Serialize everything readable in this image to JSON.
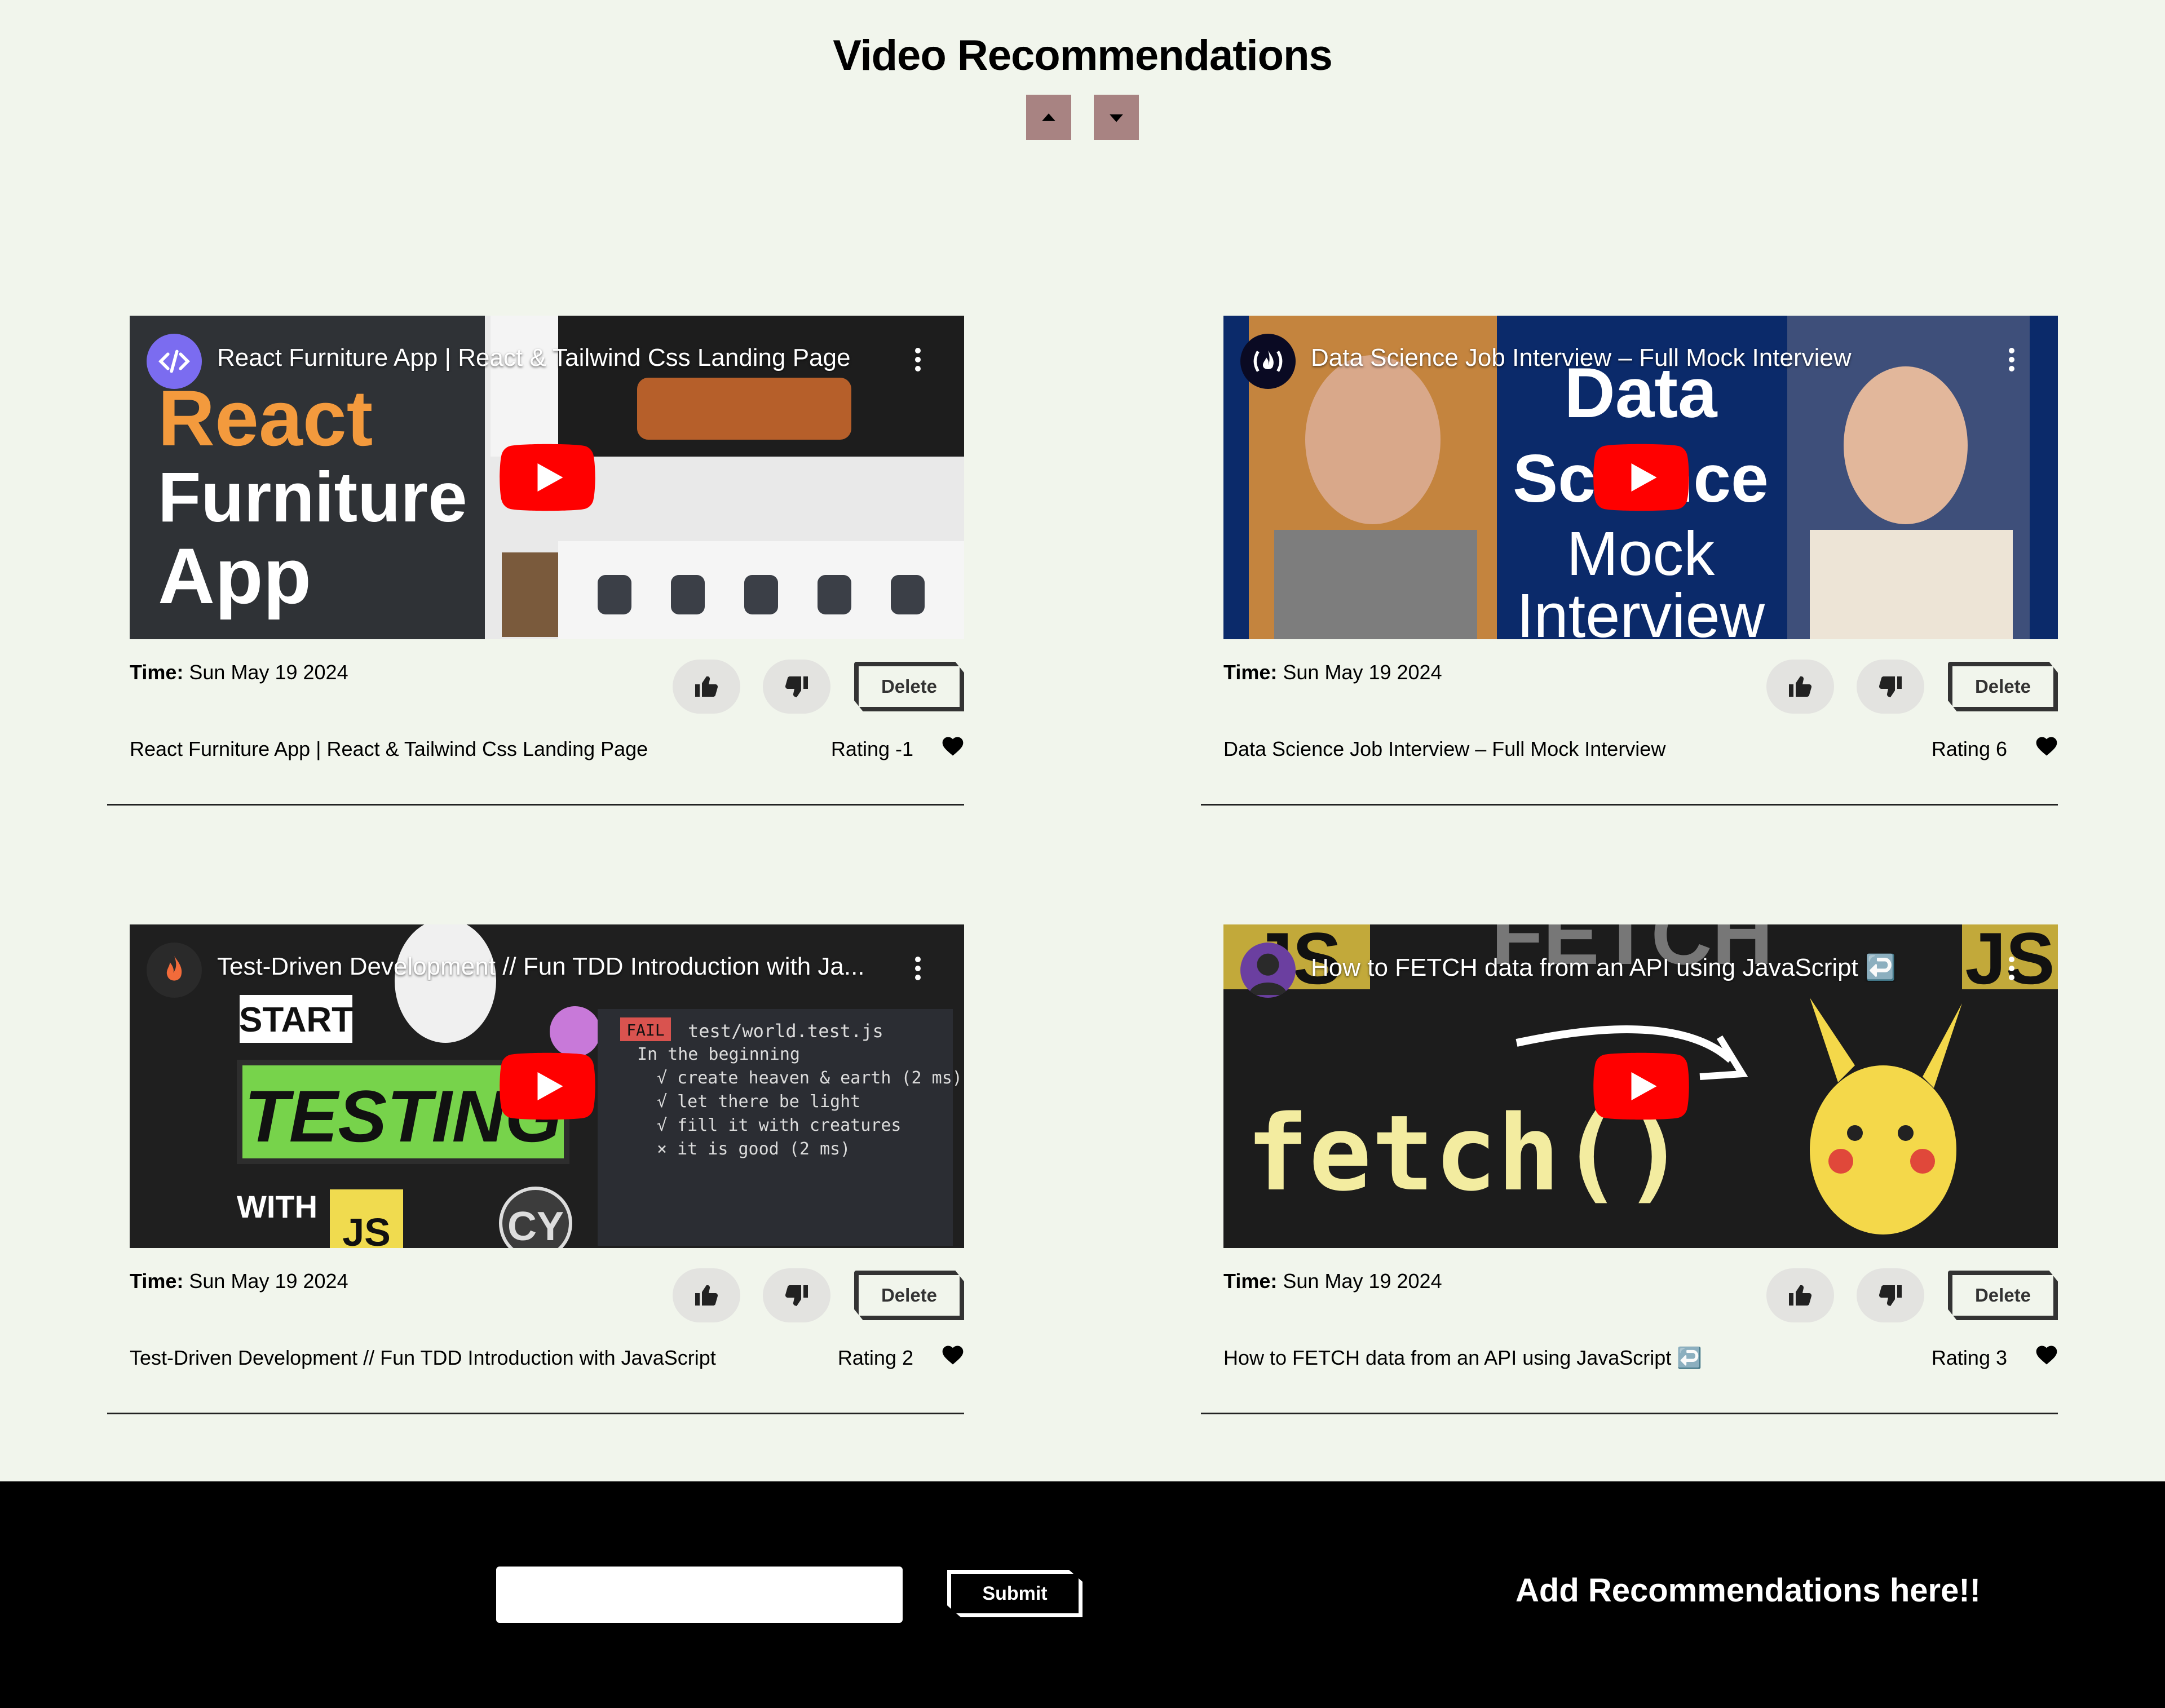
{
  "page": {
    "title": "Video Recommendations"
  },
  "sort": {
    "up_icon": "caret-up-icon",
    "down_icon": "caret-down-icon",
    "button_color": "#a88382"
  },
  "labels": {
    "time": "Time:",
    "rating": "Rating",
    "delete": "Delete"
  },
  "videos": [
    {
      "title": "React Furniture App | React & Tailwind Css Landing Page",
      "thumb_title": "React Furniture App | React & Tailwind Css Landing Page",
      "time": "Sun May 19 2024",
      "rating": "Rating -1",
      "thumb_text": [
        "React",
        "Furniture",
        "App"
      ]
    },
    {
      "title": "Data Science Job Interview – Full Mock Interview",
      "thumb_title": "Data Science Job Interview – Full Mock Interview",
      "time": "Sun May 19 2024",
      "rating": "Rating 6",
      "thumb_text": [
        "Data",
        "Science",
        "Mock",
        "Interview"
      ]
    },
    {
      "title": "Test-Driven Development // Fun TDD Introduction with JavaScript",
      "thumb_title": "Test-Driven Development // Fun TDD Introduction with Ja...",
      "time": "Sun May 19 2024",
      "rating": "Rating 2",
      "thumb_text": [
        "START",
        "TESTING",
        "WITH",
        "JS",
        "CY",
        "FAIL",
        "test/world.test.js",
        "In the beginning",
        "√ create heaven & earth (2 ms)",
        "√ let there be light",
        "√ fill it with creatures",
        "× it is good (2 ms)"
      ]
    },
    {
      "title": "How to FETCH data from an API using JavaScript ↩️",
      "thumb_title": "How to FETCH data from an API using JavaScript ↩️",
      "time": "Sun May 19 2024",
      "rating": "Rating 3",
      "thumb_text": [
        "JS",
        "FETCH",
        "JS",
        "fetch()"
      ]
    }
  ],
  "footer": {
    "input_value": "",
    "input_placeholder": "",
    "submit_label": "Submit",
    "heading": "Add Recommendations here!!"
  },
  "colors": {
    "background": "#f1f5ec",
    "footer": "#000000",
    "youtube_red": "#ff0000"
  }
}
